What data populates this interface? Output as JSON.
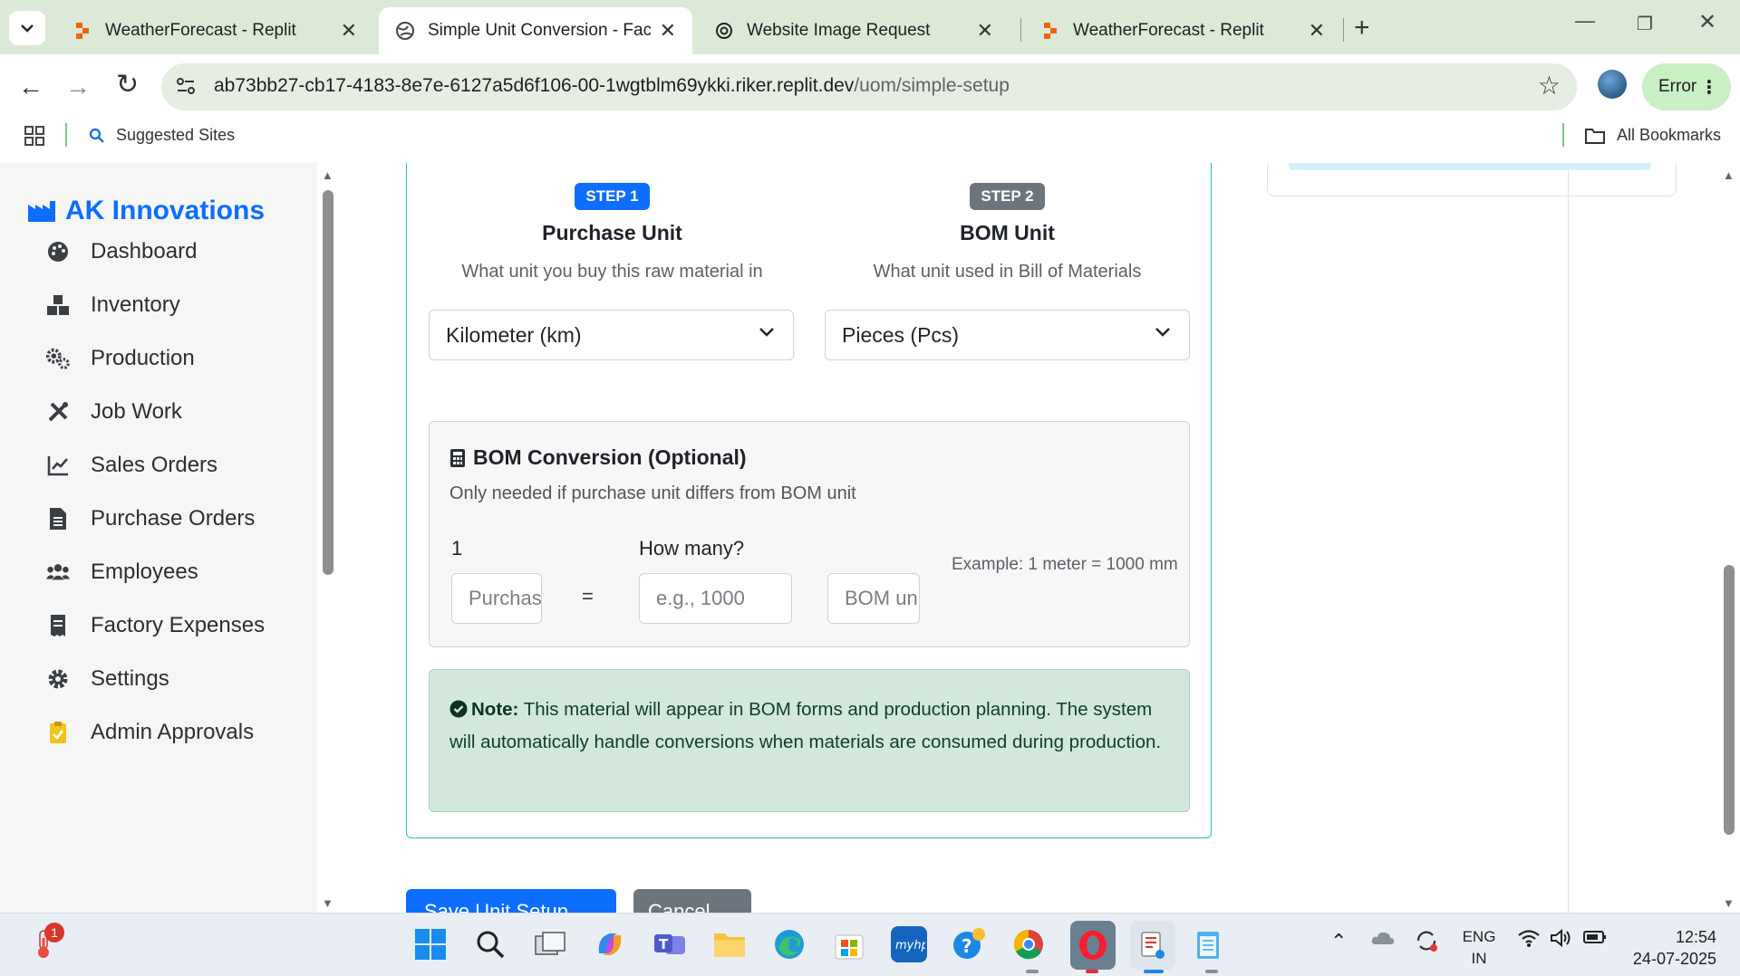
{
  "browser": {
    "tabs": [
      {
        "title": "WeatherForecast - Replit",
        "favicon": "replit-icon",
        "active": false
      },
      {
        "title": "Simple Unit Conversion - Factory",
        "favicon": "globe-icon",
        "active": true
      },
      {
        "title": "Website Image Request",
        "favicon": "chatgpt-icon",
        "active": false
      },
      {
        "title": "WeatherForecast - Replit",
        "favicon": "replit-icon",
        "active": false
      }
    ],
    "url_host": "ab73bb27-cb17-4183-8e7e-6127a5d6f106-00-1wgtblm69ykki.riker.replit.dev",
    "url_path": "/uom/simple-setup",
    "error_label": "Error",
    "bookmarks": {
      "suggested": "Suggested Sites",
      "all": "All Bookmarks"
    }
  },
  "sidebar": {
    "brand": "AK Innovations",
    "brand_color": "#0d6efd",
    "items": [
      {
        "label": "Dashboard",
        "icon": "palette-icon"
      },
      {
        "label": "Inventory",
        "icon": "boxes-icon"
      },
      {
        "label": "Production",
        "icon": "cogs-icon"
      },
      {
        "label": "Job Work",
        "icon": "tools-icon"
      },
      {
        "label": "Sales Orders",
        "icon": "chart-line-icon"
      },
      {
        "label": "Purchase Orders",
        "icon": "file-icon"
      },
      {
        "label": "Employees",
        "icon": "users-icon"
      },
      {
        "label": "Factory Expenses",
        "icon": "receipt-icon"
      },
      {
        "label": "Settings",
        "icon": "gear-icon"
      },
      {
        "label": "Admin Approvals",
        "icon": "clipboard-check-icon"
      }
    ]
  },
  "main": {
    "step1": {
      "badge": "STEP 1",
      "title": "Purchase Unit",
      "subtitle": "What unit you buy this raw material in",
      "selected": "Kilometer (km)",
      "badge_color": "#0d6efd"
    },
    "step2": {
      "badge": "STEP 2",
      "title": "BOM Unit",
      "subtitle": "What unit used in Bill of Materials",
      "selected": "Pieces (Pcs)",
      "badge_color": "#6c757d"
    },
    "conversion": {
      "title": "BOM Conversion (Optional)",
      "subtitle": "Only needed if purchase unit differs from BOM unit",
      "one_label": "1",
      "how_many_label": "How many?",
      "purchase_placeholder": "Purchase unit",
      "equals": "=",
      "quantity_placeholder": "e.g., 1000",
      "bom_placeholder": "BOM unit",
      "example": "Example: 1 meter = 1000 mm"
    },
    "note": {
      "label": "Note:",
      "text": " This material will appear in BOM forms and production planning. The system will automatically handle conversions when materials are consumed during production."
    },
    "buttons": {
      "save": "Save Unit Setup",
      "cancel": "Cancel"
    }
  },
  "taskbar": {
    "notification_count": "1",
    "lang_top": "ENG",
    "lang_bottom": "IN",
    "time": "12:54",
    "date": "24-07-2025"
  }
}
